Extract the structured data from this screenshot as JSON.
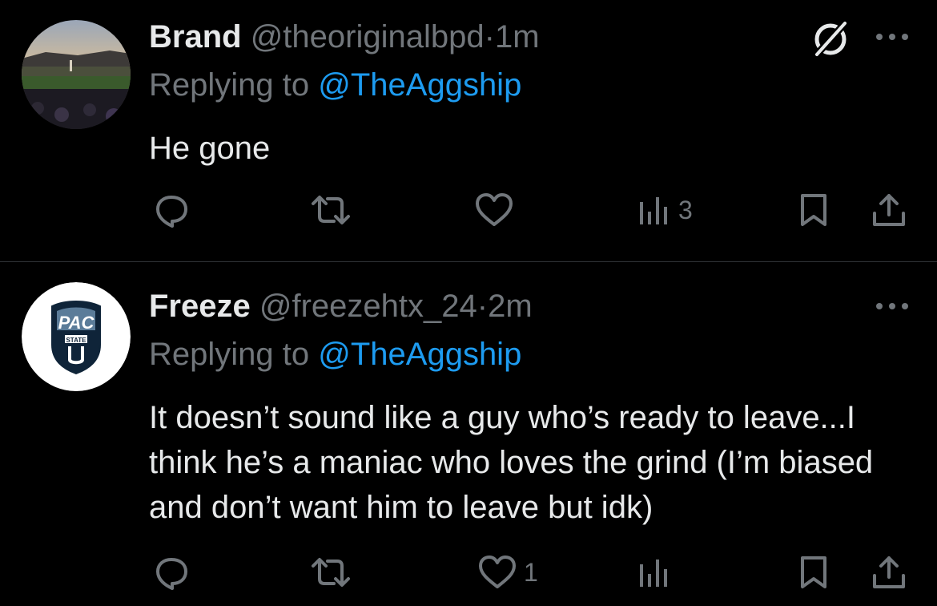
{
  "tweets": [
    {
      "display_name": "Brand",
      "handle": "@theoriginalbpd",
      "separator": "·",
      "time": "1m",
      "replying_prefix": "Replying to ",
      "replying_to": "@TheAggship",
      "text": "He gone",
      "reply_count": "",
      "retweet_count": "",
      "like_count": "",
      "view_count": "3",
      "avatar_icon": "stadium-photo-avatar",
      "extra_icon": "grok-icon"
    },
    {
      "display_name": "Freeze",
      "handle": "@freezehtx_24",
      "separator": "·",
      "time": "2m",
      "replying_prefix": "Replying to ",
      "replying_to": "@TheAggship",
      "text": "It doesn’t sound like a guy who’s ready to leave...I think he’s a maniac who loves the grind (I’m biased and don’t want him to leave but idk)",
      "reply_count": "",
      "retweet_count": "",
      "like_count": "1",
      "view_count": "",
      "avatar_icon": "pac-utah-state-logo-avatar"
    }
  ],
  "colors": {
    "background": "#000000",
    "text_primary": "#e7e9ea",
    "text_secondary": "#71767b",
    "link": "#1d9bf0",
    "divider": "#2f3336"
  },
  "icons": [
    "more-icon",
    "grok-icon",
    "reply-icon",
    "retweet-icon",
    "like-icon",
    "views-icon",
    "bookmark-icon",
    "share-icon"
  ]
}
